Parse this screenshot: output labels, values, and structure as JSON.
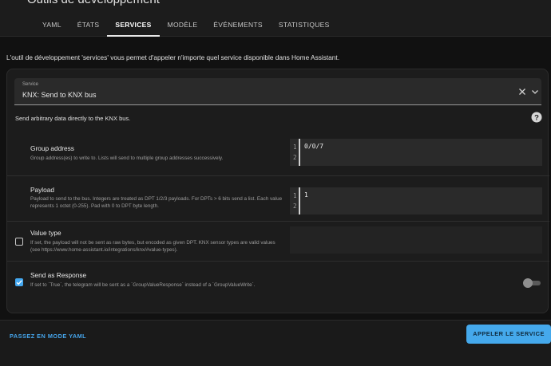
{
  "header": {
    "title": "Outils de développement",
    "tabs": [
      {
        "label": "YAML",
        "active": false
      },
      {
        "label": "ÉTATS",
        "active": false
      },
      {
        "label": "SERVICES",
        "active": true
      },
      {
        "label": "MODÈLE",
        "active": false
      },
      {
        "label": "ÉVÉNEMENTS",
        "active": false
      },
      {
        "label": "STATISTIQUES",
        "active": false
      }
    ]
  },
  "intro": "L'outil de développement 'services' vous permet d'appeler n'importe quel service disponible dans Home Assistant.",
  "service_picker": {
    "label": "Service",
    "value": "KNX: Send to KNX bus"
  },
  "service_description": "Send arbitrary data directly to the KNX bus.",
  "fields": {
    "group_address": {
      "title": "Group address",
      "description": "Group address(es) to write to. Lists will send to multiple group addresses successively.",
      "line_numbers": [
        "1",
        "2"
      ],
      "value": "0/0/7"
    },
    "payload": {
      "title": "Payload",
      "description": "Payload to send to the bus. Integers are treated as DPT 1/2/3 payloads. For DPTs > 6 bits send a list. Each value represents 1 octet (0-255). Pad with 0 to DPT byte length.",
      "line_numbers": [
        "1",
        "2"
      ],
      "value": "1"
    },
    "value_type": {
      "title": "Value type",
      "description": "If set, the payload will not be sent as raw bytes, but encoded as given DPT. KNX sensor types are valid values (see https://www.home-assistant.io/integrations/knx/#value-types).",
      "checked": false
    },
    "send_as_response": {
      "title": "Send as Response",
      "description": "If set to `True`, the telegram will be sent as a `GroupValueResponse` instead of a `GroupValueWrite`.",
      "checked": true,
      "toggle_on": false
    }
  },
  "footer": {
    "yaml_mode_label": "PASSEZ EN MODE YAML",
    "call_service_label": "APPELER LE SERVICE"
  },
  "colors": {
    "accent": "#45a9ec",
    "background": "#111111",
    "card": "#1c1c1c"
  }
}
